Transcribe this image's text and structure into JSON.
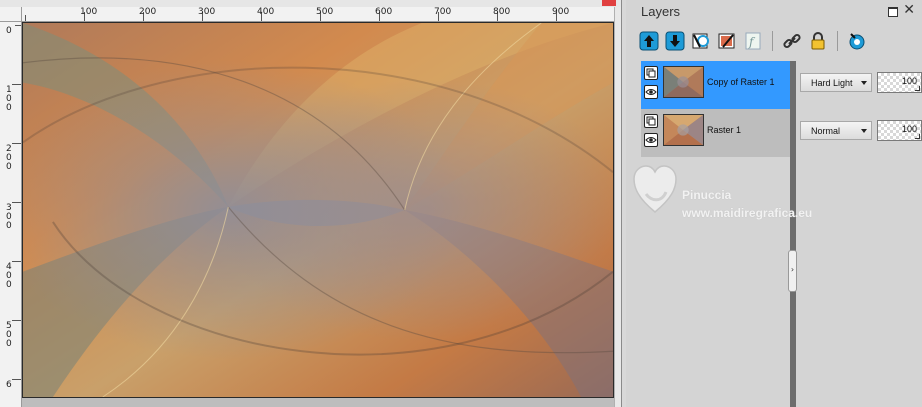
{
  "canvas": {
    "ruler_top_labels": [
      "100",
      "200",
      "300",
      "400",
      "500",
      "600",
      "700",
      "800",
      "900"
    ],
    "ruler_left_labels": [
      "0",
      "100",
      "200",
      "300",
      "400",
      "500",
      "6"
    ]
  },
  "layers": {
    "title": "Layers",
    "toolbar_icons": [
      "move-layer-up-icon",
      "move-layer-down-icon",
      "new-layer-icon",
      "layer-properties-icon",
      "fx-effects-icon",
      "link-icon",
      "lock-icon",
      "mask-icon"
    ],
    "items": [
      {
        "name": "Copy of Raster 1",
        "blend_mode": "Hard Light",
        "opacity": "100",
        "selected": true
      },
      {
        "name": "Raster 1",
        "blend_mode": "Normal",
        "opacity": "100",
        "selected": false
      }
    ]
  },
  "watermark": {
    "line1": "Pinuccia",
    "line2": "www.maidiregrafica.eu"
  },
  "colors": {
    "selection": "#3399ff",
    "panel_bg": "#d4d4d4",
    "toolbar_accent": "#1e9bd7"
  }
}
